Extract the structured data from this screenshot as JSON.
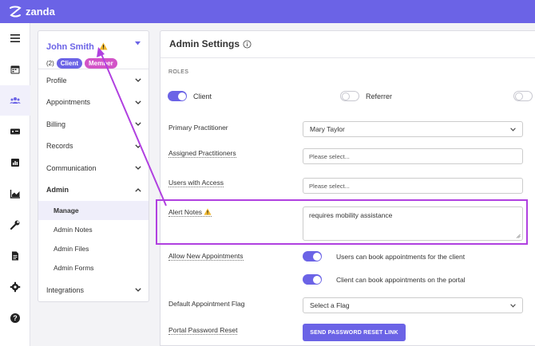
{
  "app": {
    "brand": "zanda",
    "brand_color": "#6b63e6"
  },
  "rail": {
    "items": [
      {
        "icon": "menu-icon"
      },
      {
        "icon": "calendar-icon"
      },
      {
        "icon": "users-icon",
        "active": true
      },
      {
        "icon": "billing-icon"
      },
      {
        "icon": "reports-icon"
      },
      {
        "icon": "chart-icon"
      },
      {
        "icon": "wrench-icon"
      },
      {
        "icon": "document-icon"
      },
      {
        "icon": "gear-icon"
      },
      {
        "icon": "help-icon"
      }
    ]
  },
  "client_panel": {
    "name": "John Smith",
    "count": "(2)",
    "badges": {
      "client": "Client",
      "member": "Member"
    },
    "nav": {
      "profile": "Profile",
      "appointments": "Appointments",
      "billing": "Billing",
      "records": "Records",
      "communication": "Communication",
      "admin": "Admin",
      "integrations": "Integrations"
    },
    "admin_sub": {
      "manage": "Manage",
      "admin_notes": "Admin Notes",
      "admin_files": "Admin Files",
      "admin_forms": "Admin Forms"
    }
  },
  "settings": {
    "title": "Admin Settings",
    "roles_heading": "ROLES",
    "roles": {
      "client": {
        "label": "Client",
        "on": true
      },
      "referrer": {
        "label": "Referrer",
        "on": false
      }
    },
    "primary_practitioner": {
      "label": "Primary Practitioner",
      "value": "Mary Taylor"
    },
    "assigned_practitioners": {
      "label": "Assigned Practitioners",
      "placeholder": "Please select..."
    },
    "users_with_access": {
      "label": "Users with Access",
      "placeholder": "Please select..."
    },
    "alert_notes": {
      "label": "Alert Notes",
      "value": "requires mobility assistance"
    },
    "allow_new_appointments": {
      "label": "Allow New Appointments",
      "option1": "Users can book appointments for the client",
      "option2": "Client can book appointments on the portal"
    },
    "default_flag": {
      "label": "Default Appointment Flag",
      "value": "Select a Flag"
    },
    "portal_password": {
      "label": "Portal Password Reset",
      "button": "SEND PASSWORD RESET LINK"
    }
  },
  "annotation_color": "#b040e0"
}
